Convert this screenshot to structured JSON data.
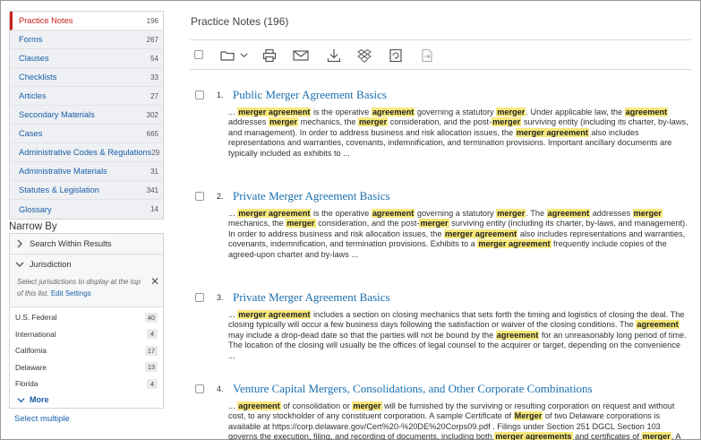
{
  "categories": [
    {
      "label": "Practice Notes",
      "count": "196",
      "active": true
    },
    {
      "label": "Forms",
      "count": "267"
    },
    {
      "label": "Clauses",
      "count": "54"
    },
    {
      "label": "Checklists",
      "count": "33"
    },
    {
      "label": "Articles",
      "count": "27"
    },
    {
      "label": "Secondary Materials",
      "count": "302"
    },
    {
      "label": "Cases",
      "count": "665"
    },
    {
      "label": "Administrative Codes & Regulations",
      "count": "29"
    },
    {
      "label": "Administrative Materials",
      "count": "31"
    },
    {
      "label": "Statutes & Legislation",
      "count": "341"
    },
    {
      "label": "Glossary",
      "count": "14"
    }
  ],
  "narrow": {
    "title": "Narrow By",
    "search_within": "Search Within Results",
    "jurisdiction_label": "Jurisdiction",
    "jurisdiction_desc": "Select jurisdictions to display at the top of this list.",
    "edit_settings": "Edit Settings",
    "jurisdictions": [
      {
        "name": "U.S. Federal",
        "count": "40"
      },
      {
        "name": "International",
        "count": "4"
      },
      {
        "name": "California",
        "count": "17"
      },
      {
        "name": "Delaware",
        "count": "13"
      },
      {
        "name": "Florida",
        "count": "4"
      }
    ],
    "more": "More",
    "select_multiple": "Select multiple"
  },
  "results_title": "Practice Notes (196)",
  "icons": [
    "checkbox",
    "folder-icon",
    "print-icon",
    "email-icon",
    "download-icon",
    "dropbox-icon",
    "alert-icon",
    "export-icon"
  ],
  "results": [
    {
      "num": "1.",
      "title": "Public Merger Agreement Basics",
      "snippet": "... [[merger agreement]] is the operative [[agreement]] governing a statutory [[merger]]. Under applicable law, the [[agreement]] addresses [[merger]] mechanics, the [[merger]] consideration, and the post-[[merger]] surviving entity (including its charter, by-laws, and management). In order to address business and risk allocation issues, the [[merger agreement]] also includes representations and warranties, covenants, indemnification, and termination provisions. Important ancillary documents are typically included as exhibits to ..."
    },
    {
      "num": "2.",
      "title": "Private Merger Agreement Basics",
      "snippet": "... [[merger agreement]] is the operative [[agreement]] governing a statutory [[merger]]. The [[agreement]] addresses [[merger]] mechanics, the [[merger]] consideration, and the post-[[merger]] surviving entity (including its charter, by-laws, and management). In order to address business and risk allocation issues, the [[merger agreement]] also includes representations and warranties, covenants, indemnification, and termination provisions. Exhibits to a [[merger agreement]] frequently include copies of the agreed-upon charter and by-laws ..."
    },
    {
      "num": "3.",
      "title": "Private Merger Agreement Basics",
      "snippet": "... [[merger agreement]] includes a section on closing mechanics that sets forth the timing and logistics of closing the deal. The closing typically will occur a few business days following the satisfaction or waiver of the closing conditions. The [[agreement]] may include a drop-dead date so that the parties will not be bound by the [[agreement]] for an unreasonably long period of time. The location of the closing will usually be the offices of legal counsel to the acquirer or target, depending on the convenience ..."
    },
    {
      "num": "4.",
      "title": "Venture Capital Mergers, Consolidations, and Other Corporate Combinations",
      "snippet": "... [[agreement]] of consolidation or [[merger]] will be furnished by the surviving or resulting corporation on request and without cost, to any stockholder of any constituent corporation. A sample Certificate of [[Merger]] of two Delaware corporations is available at https://corp.delaware.gov/Cert%20-%20DE%20Corps09.pdf . Filings under Section 251 DGCL Section 103 governs the execution, filing, and recording of documents, including both [[merger agreements]] and certificates of [[merger]]. A [[merger]] ..."
    }
  ]
}
